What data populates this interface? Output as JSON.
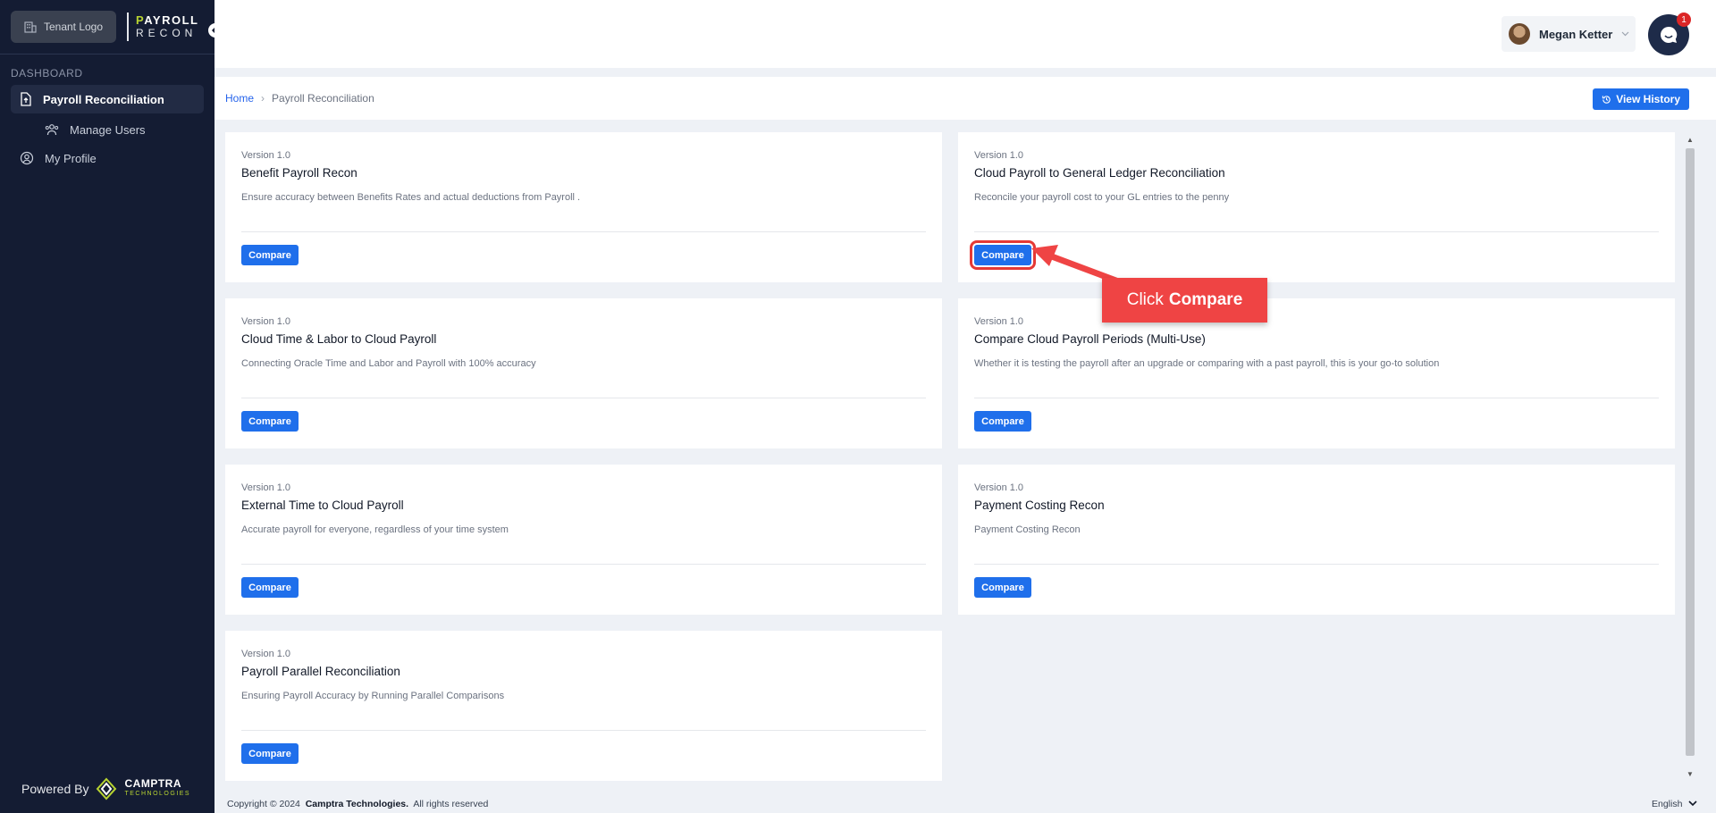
{
  "sidebar": {
    "tenant_logo": "Tenant Logo",
    "brand_top_first": "P",
    "brand_top_rest": "AYROLL",
    "brand_bottom": "RECON",
    "section": "DASHBOARD",
    "items": [
      {
        "label": "Payroll Reconciliation",
        "icon": "file-upload-icon"
      },
      {
        "label": "Manage Users",
        "icon": "users-icon"
      },
      {
        "label": "My Profile",
        "icon": "user-circle-icon"
      }
    ],
    "powered_by": "Powered By",
    "camptra_name": "CAMPTRA",
    "camptra_sub": "TECHNOLOGIES"
  },
  "header": {
    "user_name": "Megan Ketter",
    "chat_badge": "1"
  },
  "breadcrumb": {
    "home": "Home",
    "current": "Payroll Reconciliation",
    "view_history": "View History"
  },
  "cards": [
    {
      "version": "Version 1.0",
      "title": "Benefit Payroll Recon",
      "description": "Ensure accuracy between Benefits Rates and actual deductions from Payroll .",
      "button": "Compare"
    },
    {
      "version": "Version 1.0",
      "title": "Cloud Payroll to General Ledger Reconciliation",
      "description": "Reconcile your payroll cost to your GL entries to the penny",
      "button": "Compare"
    },
    {
      "version": "Version 1.0",
      "title": "Cloud Time & Labor to Cloud Payroll",
      "description": "Connecting Oracle Time and Labor and Payroll with 100% accuracy",
      "button": "Compare"
    },
    {
      "version": "Version 1.0",
      "title": "Compare Cloud Payroll Periods (Multi-Use)",
      "description": "Whether it is testing the payroll after an upgrade or comparing with a past payroll, this is your go-to solution",
      "button": "Compare"
    },
    {
      "version": "Version 1.0",
      "title": "External Time to Cloud Payroll",
      "description": "Accurate payroll for everyone, regardless of your time system",
      "button": "Compare"
    },
    {
      "version": "Version 1.0",
      "title": "Payment Costing Recon",
      "description": "Payment Costing Recon",
      "button": "Compare"
    },
    {
      "version": "Version 1.0",
      "title": "Payroll Parallel Reconciliation",
      "description": "Ensuring Payroll Accuracy by Running Parallel Comparisons",
      "button": "Compare"
    }
  ],
  "callout": {
    "prefix": "Click",
    "bold": "Compare",
    "color": "#ef4444"
  },
  "footer": {
    "copyright": "Copyright © 2024",
    "company": "Camptra Technologies.",
    "rights": "All rights reserved",
    "language": "English"
  },
  "colors": {
    "accent": "#1f6feb",
    "sidebar": "#141c33",
    "brand_green": "#b8d431"
  }
}
